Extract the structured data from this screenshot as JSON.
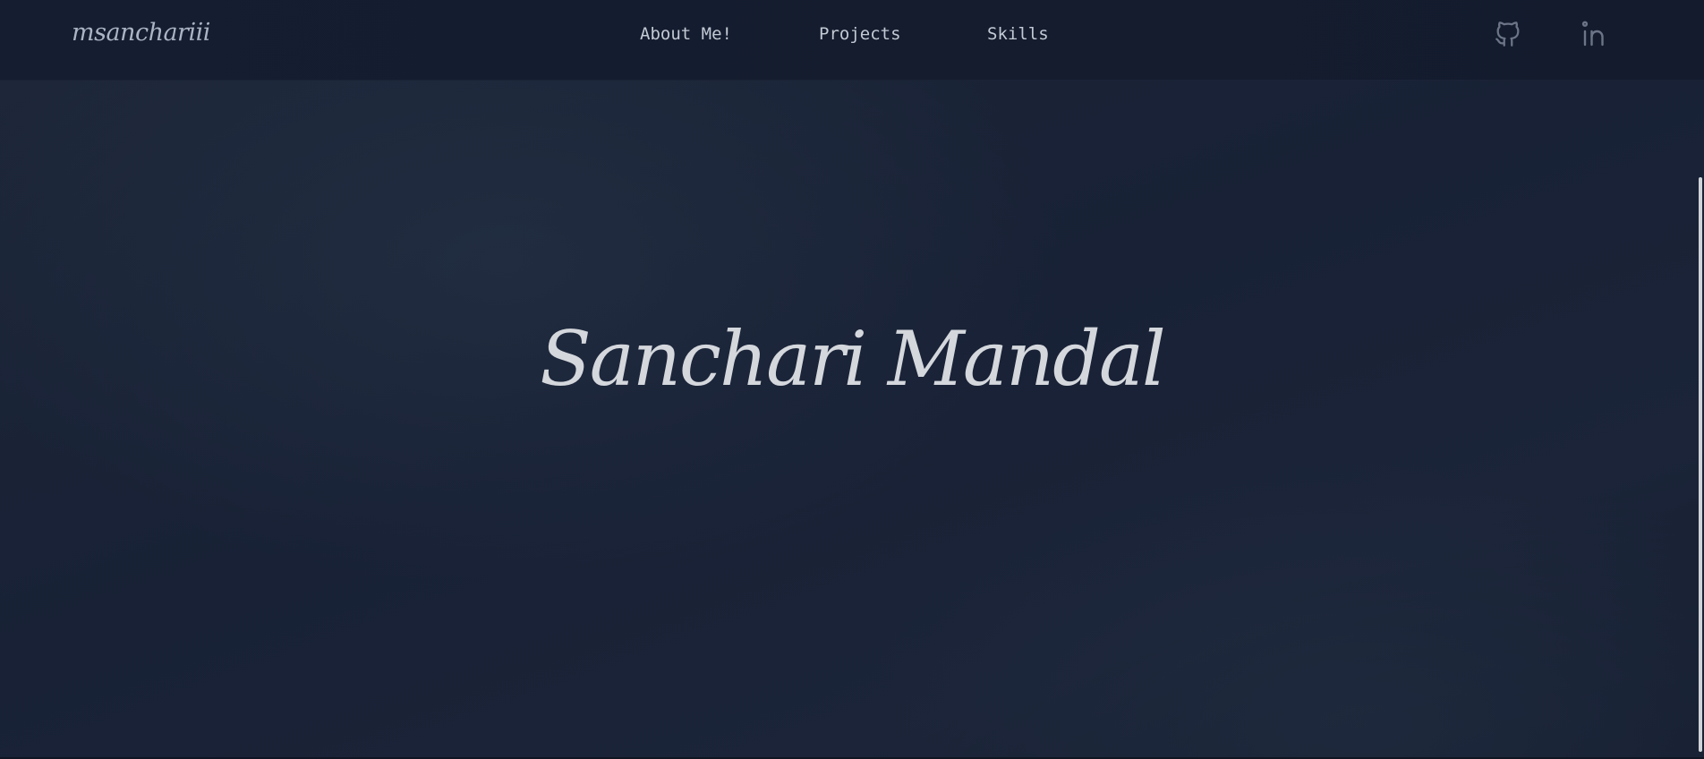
{
  "header": {
    "brand": "msanchariii",
    "nav": [
      {
        "label": "About Me!"
      },
      {
        "label": "Projects"
      },
      {
        "label": "Skills"
      }
    ],
    "social": [
      {
        "icon": "github-icon"
      },
      {
        "icon": "linkedin-icon"
      }
    ]
  },
  "hero": {
    "title": "Sanchari Mandal"
  },
  "colors": {
    "background": "#172033",
    "header_background": "#141c2f",
    "text": "#c3cad4",
    "hero_text": "#d4d7dc",
    "icon": "#6b7587"
  }
}
